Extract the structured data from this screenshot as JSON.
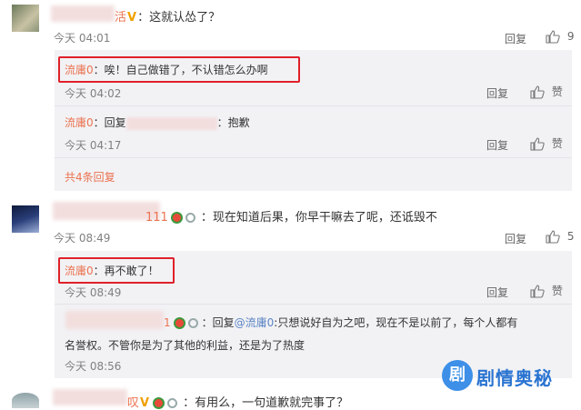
{
  "comment1": {
    "name_tail": "活",
    "text": "：这就认怂了？",
    "time": "今天 04:01",
    "reply_label": "回复",
    "like_count": "9"
  },
  "reply1": {
    "name": "流庸0",
    "text": "：唉！自己做错了，不认错怎么办啊",
    "time": "今天 04:02",
    "reply_label": "回复",
    "like_label": "赞"
  },
  "reply2": {
    "name": "流庸0",
    "text_prefix": "：回复",
    "text_tail": "：抱歉",
    "time": "今天 04:17",
    "reply_label": "回复",
    "like_label": "赞"
  },
  "more_replies": "共4条回复",
  "comment2": {
    "name_tail": "111",
    "text": "：现在知道后果，你早干嘛去了呢，还诋毁不",
    "time": "今天 08:49",
    "reply_label": "回复",
    "like_count": "5"
  },
  "reply3": {
    "name": "流庸0",
    "text": "：再不敢了！",
    "time": "今天 08:49",
    "reply_label": "回复",
    "like_label": "赞"
  },
  "reply4": {
    "name_tail": "1",
    "text_prefix": "：回复",
    "mention": "@流庸0",
    "text_line1": ":只想说好自为之吧，现在不是以前了，每个人都有",
    "text_line2": "名誉权。不管你是为了其他的利益，还是为了热度",
    "time": "今天 08:56"
  },
  "comment3": {
    "name_tail": "叹",
    "text": "：有用么，一句道歉就完事了？"
  },
  "watermark": {
    "icon": "剧",
    "text": "剧情奥秘"
  },
  "colors": {
    "name": "#eb7350",
    "mention": "#5b84c4",
    "highlight": "#e0202a",
    "watermark": "#2a74d1"
  }
}
